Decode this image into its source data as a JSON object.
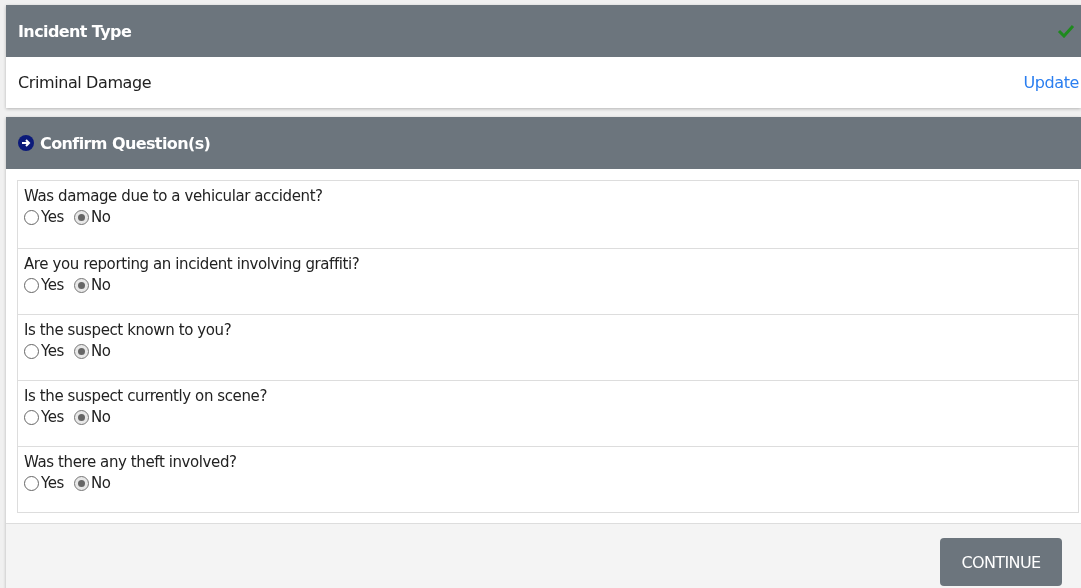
{
  "incident_type": {
    "title": "Incident Type",
    "complete": true,
    "value": "Criminal Damage",
    "update_link": "Update"
  },
  "confirm_questions": {
    "title": "Confirm Question(s)",
    "questions": [
      {
        "text": "Was damage due to a vehicular accident?",
        "options": [
          {
            "label": "Yes",
            "selected": false
          },
          {
            "label": "No",
            "selected": true
          }
        ]
      },
      {
        "text": "Are you reporting an incident involving graffiti?",
        "options": [
          {
            "label": "Yes",
            "selected": false
          },
          {
            "label": "No",
            "selected": true
          }
        ]
      },
      {
        "text": "Is the suspect known to you?",
        "options": [
          {
            "label": "Yes",
            "selected": false
          },
          {
            "label": "No",
            "selected": true
          }
        ]
      },
      {
        "text": "Is the suspect currently on scene?",
        "options": [
          {
            "label": "Yes",
            "selected": false
          },
          {
            "label": "No",
            "selected": true
          }
        ]
      },
      {
        "text": "Was there any theft involved?",
        "options": [
          {
            "label": "Yes",
            "selected": false
          },
          {
            "label": "No",
            "selected": true
          }
        ]
      }
    ],
    "continue_button": "CONTINUE"
  }
}
